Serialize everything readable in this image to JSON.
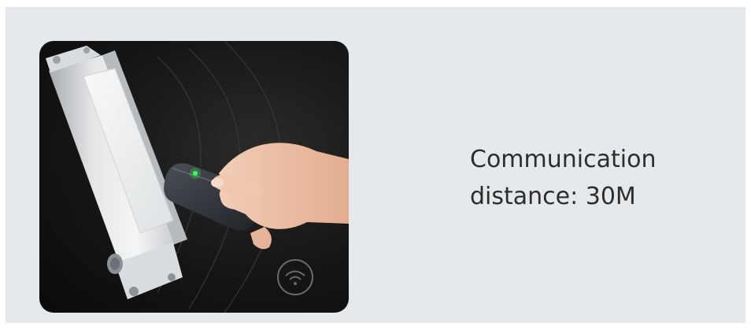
{
  "caption": {
    "line1": "Communication",
    "line2": "distance: 30M"
  },
  "colors": {
    "panel_background": "#e5e9ec",
    "caption_text": "#2d2d2d",
    "photo_background": "#151515",
    "led": "#33ff55"
  },
  "icons": {
    "wifi": "wifi-icon",
    "led": "indicator-led"
  }
}
